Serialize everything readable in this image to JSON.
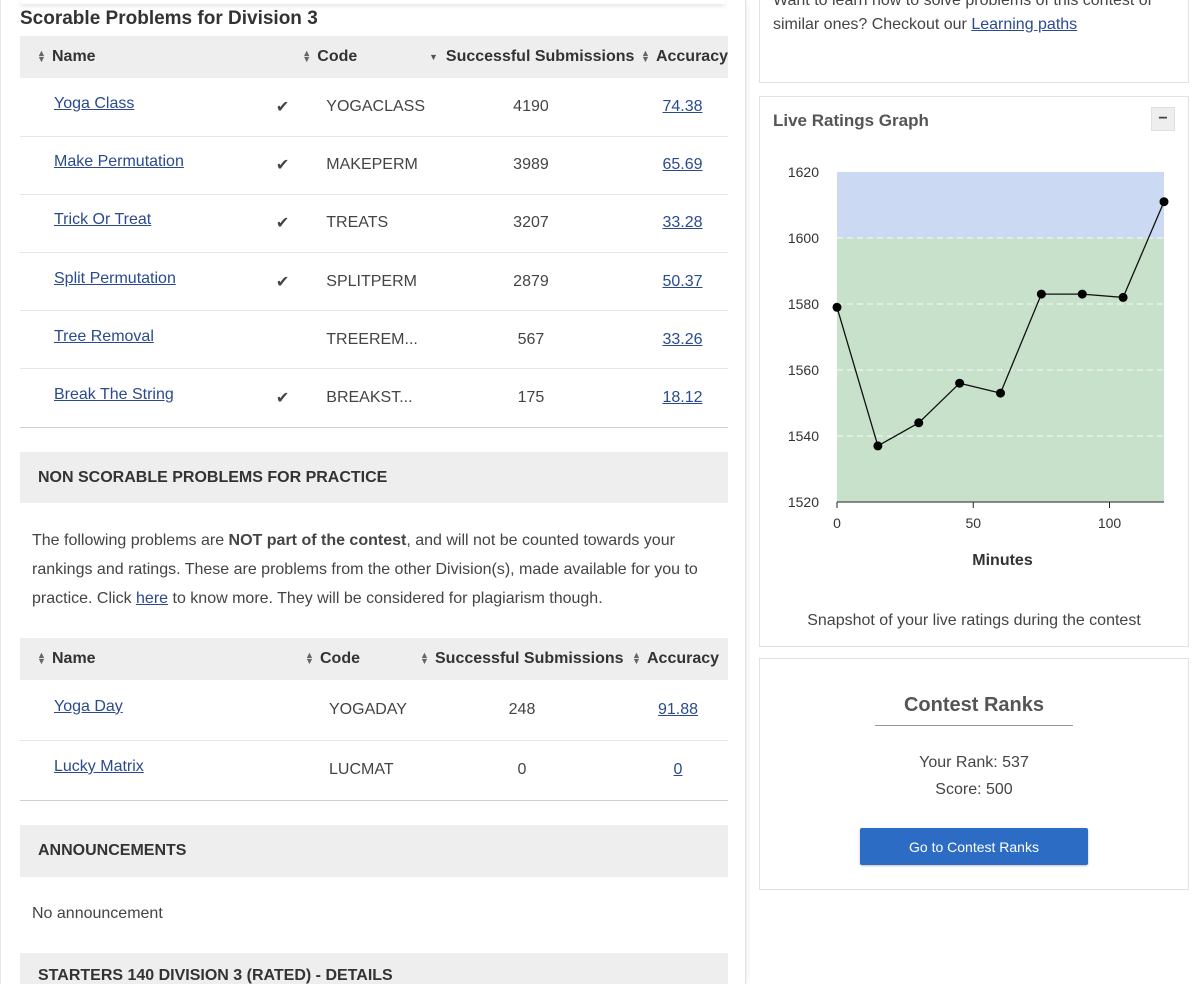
{
  "scorable": {
    "title": "Scorable Problems for Division 3",
    "headers": {
      "name": "Name",
      "code": "Code",
      "submissions": "Successful Submissions",
      "accuracy": "Accuracy"
    },
    "rows": [
      {
        "name": "Yoga Class",
        "solved": true,
        "code": "YOGACLASS",
        "submissions": "4190",
        "accuracy": "74.38"
      },
      {
        "name": "Make Permutation",
        "solved": true,
        "code": "MAKEPERM",
        "submissions": "3989",
        "accuracy": "65.69"
      },
      {
        "name": "Trick Or Treat",
        "solved": true,
        "code": "TREATS",
        "submissions": "3207",
        "accuracy": "33.28"
      },
      {
        "name": "Split Permutation",
        "solved": true,
        "code": "SPLITPERM",
        "submissions": "2879",
        "accuracy": "50.37"
      },
      {
        "name": "Tree Removal",
        "solved": false,
        "code": "TREEREM...",
        "submissions": "567",
        "accuracy": "33.26"
      },
      {
        "name": "Break The String",
        "solved": true,
        "code": "BREAKST...",
        "submissions": "175",
        "accuracy": "18.12"
      }
    ]
  },
  "practice": {
    "heading": "NON SCORABLE PROBLEMS FOR PRACTICE",
    "text_1": "The following problems are ",
    "text_bold": "NOT part of the contest",
    "text_2": ", and will not be counted towards your rankings and ratings. These are problems from the other Division(s), made available for you to practice. Click ",
    "text_link": "here",
    "text_3": " to know more. They will be considered for plagiarism though.",
    "headers": {
      "name": "Name",
      "code": "Code",
      "submissions": "Successful Submissions",
      "accuracy": "Accuracy"
    },
    "rows": [
      {
        "name": "Yoga Day",
        "code": "YOGADAY",
        "submissions": "248",
        "accuracy": "91.88"
      },
      {
        "name": "Lucky Matrix",
        "code": "LUCMAT",
        "submissions": "0",
        "accuracy": "0"
      }
    ]
  },
  "announcements": {
    "heading": "ANNOUNCEMENTS",
    "empty_text": "No announcement"
  },
  "details": {
    "heading": "STARTERS 140 DIVISION 3 (RATED) - DETAILS"
  },
  "learn": {
    "text": "Want to learn how to solve problems of this contest or similar ones? Checkout our ",
    "link": "Learning paths"
  },
  "graph": {
    "title": "Live Ratings Graph",
    "collapse_symbol": "−",
    "snapshot_text": "Snapshot of your live ratings during the contest"
  },
  "ranks": {
    "title": "Contest Ranks",
    "your_rank": "Your Rank: 537",
    "score": "Score: 500",
    "button_label": "Go to Contest Ranks"
  },
  "colors": {
    "band_blue": "#ccd9f2",
    "band_green": "#c8e1cb",
    "button_blue": "#2d6cc4",
    "check_green": "#6bb36b"
  },
  "chart_data": {
    "type": "line",
    "xlabel": "Minutes",
    "ylabel": "",
    "x": [
      0,
      15,
      30,
      45,
      60,
      75,
      90,
      105,
      120
    ],
    "values": [
      1579,
      1537,
      1544,
      1556,
      1553,
      1583,
      1583,
      1582,
      1611
    ],
    "xlim": [
      0,
      120
    ],
    "ylim": [
      1520,
      1620
    ],
    "xticks": [
      0,
      50,
      100
    ],
    "yticks": [
      1520,
      1540,
      1560,
      1580,
      1600,
      1620
    ],
    "bands": [
      {
        "from": 1520,
        "to": 1600,
        "color": "#c8e1cb"
      },
      {
        "from": 1600,
        "to": 1620,
        "color": "#ccd9f2"
      }
    ],
    "grid": true
  }
}
